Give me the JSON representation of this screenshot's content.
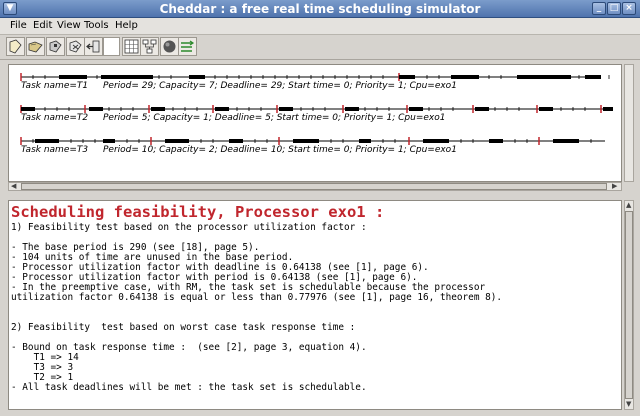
{
  "window": {
    "title": "Cheddar : a free real time scheduling simulator"
  },
  "menubar": {
    "items": [
      "File",
      "Edit",
      "View",
      "Tools",
      "Help"
    ]
  },
  "toolbar": {
    "icons": [
      "new-icon",
      "open-icon",
      "save-icon",
      "close-file-icon",
      "exit-icon",
      "blank-field",
      "grid-icon",
      "network-icon",
      "sphere-icon",
      "simulate-icon"
    ]
  },
  "gantt": {
    "tasks": [
      {
        "label": "Task name=T1",
        "details": "Period= 29; Capacity= 7; Deadline= 29; Start time= 0; Priority= 1; Cpu=exo1"
      },
      {
        "label": "Task name=T2",
        "details": "Period= 5; Capacity= 1; Deadline= 5; Start time= 0; Priority= 1; Cpu=exo1"
      },
      {
        "label": "Task name=T3",
        "details": "Period= 10; Capacity= 2; Deadline= 10; Start time= 0; Priority= 1; Cpu=exo1"
      }
    ]
  },
  "report": {
    "heading": "Scheduling feasibility, Processor exo1 :",
    "lines": [
      "1) Feasibility test based on the processor utilization factor :",
      "",
      "- The base period is 290 (see [18], page 5).",
      "- 104 units of time are unused in the base period.",
      "- Processor utilization factor with deadline is 0.64138 (see [1], page 6).",
      "- Processor utilization factor with period is 0.64138 (see [1], page 6).",
      "- In the preemptive case, with RM, the task set is schedulable because the processor",
      "utilization factor 0.64138 is equal or less than 0.77976 (see [1], page 16, theorem 8).",
      "",
      "",
      "2) Feasibility  test based on worst case task response time :",
      "",
      "- Bound on task response time :  (see [2], page 3, equation 4).",
      "    T1 => 14",
      "    T3 => 3",
      "    T2 => 1",
      "- All task deadlines will be met : the task set is schedulable."
    ]
  }
}
